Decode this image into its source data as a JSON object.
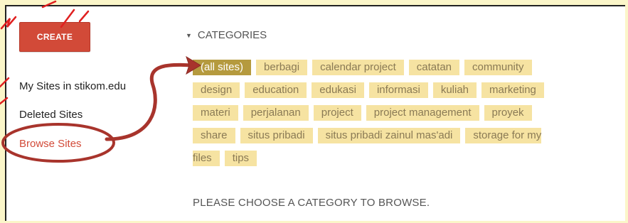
{
  "sidebar": {
    "create_label": "CREATE",
    "items": [
      {
        "label": "My Sites in stikom.edu"
      },
      {
        "label": "Deleted Sites"
      },
      {
        "label": "Browse Sites"
      }
    ]
  },
  "categories": {
    "header": "CATEGORIES",
    "selected": "(all sites)",
    "tags": [
      "(all sites)",
      "berbagi",
      "calendar project",
      "catatan",
      "community",
      "design",
      "education",
      "edukasi",
      "informasi",
      "kuliah",
      "marketing",
      "materi",
      "perjalanan",
      "project",
      "project management",
      "proyek",
      "share",
      "situs pribadi",
      "situs pribadi zainul mas'adi",
      "storage for my",
      "files",
      "tips"
    ]
  },
  "main": {
    "prompt": "PLEASE CHOOSE A CATEGORY TO BROWSE."
  },
  "colors": {
    "accent": "#d24a38",
    "tag_bg": "#f6e3a2",
    "tag_selected": "#b59a3e",
    "annotation": "#a8342c"
  }
}
